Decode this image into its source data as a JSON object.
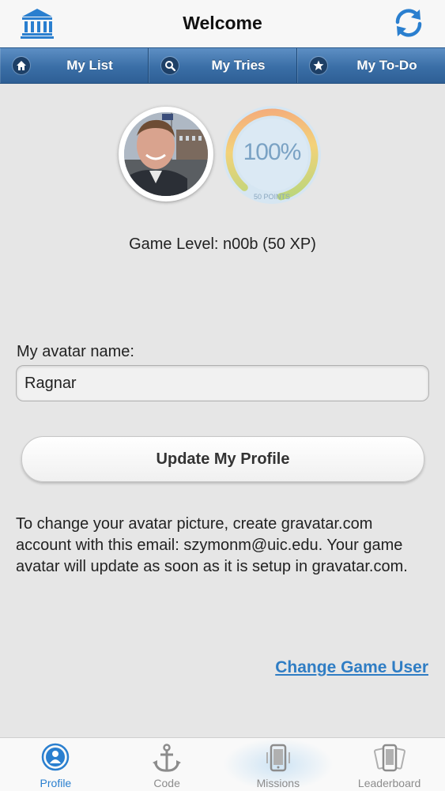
{
  "header": {
    "title": "Welcome",
    "home_icon": "museum-icon",
    "refresh_icon": "refresh-icon",
    "accent_color": "#2a7fcf"
  },
  "nav": {
    "items": [
      {
        "label": "My List",
        "icon": "home-icon"
      },
      {
        "label": "My Tries",
        "icon": "search-icon"
      },
      {
        "label": "My To-Do",
        "icon": "star-icon"
      }
    ]
  },
  "profile": {
    "gauge_percent": "100%",
    "gauge_points": "50 POINTS",
    "game_level": "Game Level: n00b (50 XP)",
    "avatar_name_label": "My avatar name:",
    "avatar_name_value": "Ragnar",
    "update_button": "Update My Profile",
    "info_text": "To change your avatar picture, create gravatar.com account with this email: szymonm@uic.edu. Your game avatar will update as soon as it is setup in gravatar.com.",
    "change_user_link": "Change Game User"
  },
  "tabs": [
    {
      "label": "Profile",
      "icon": "user-circle-icon",
      "active": true
    },
    {
      "label": "Code",
      "icon": "anchor-icon",
      "active": false
    },
    {
      "label": "Missions",
      "icon": "phone-icon",
      "active": false
    },
    {
      "label": "Leaderboard",
      "icon": "phones-icon",
      "active": false
    }
  ]
}
